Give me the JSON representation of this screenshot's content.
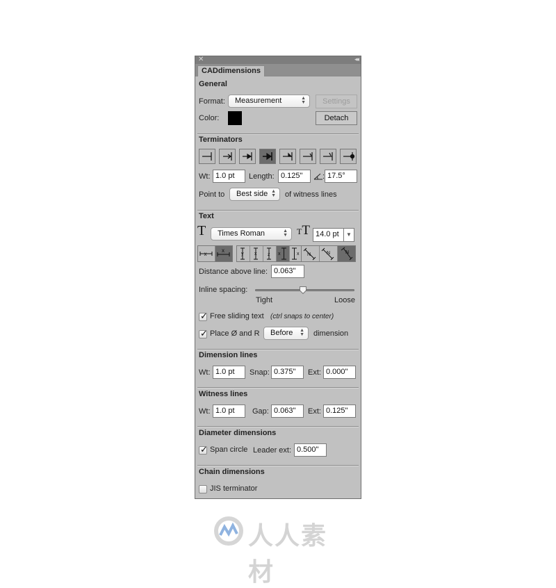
{
  "panel": {
    "close_icon": "close-icon",
    "collapse_icon": "double-chevron-left-icon",
    "tab_label": "CADdimensions"
  },
  "general": {
    "title": "General",
    "format_label": "Format:",
    "format_value": "Measurement",
    "settings_label": "Settings",
    "color_label": "Color:",
    "color_value": "#000000",
    "detach_label": "Detach"
  },
  "terminators": {
    "title": "Terminators",
    "styles": [
      {
        "name": "bar",
        "selected": false
      },
      {
        "name": "open-arrow-bar",
        "selected": false
      },
      {
        "name": "filled-arrow-bar",
        "selected": false
      },
      {
        "name": "bold-filled-arrow-bar",
        "selected": true
      },
      {
        "name": "half-arrow-bar",
        "selected": false
      },
      {
        "name": "slash-bar",
        "selected": false
      },
      {
        "name": "half-slash-bar",
        "selected": false
      },
      {
        "name": "dot-bar",
        "selected": false
      }
    ],
    "wt_label": "Wt:",
    "wt_value": "1.0 pt",
    "length_label": "Length:",
    "length_value": "0.125\"",
    "angle_icon": "angle-icon",
    "angle_value": "17.5°",
    "point_to_label": "Point to",
    "point_to_value": "Best side",
    "witness_suffix": "of witness lines"
  },
  "text": {
    "title": "Text",
    "font_icon": "font-T-icon",
    "font_value": "Times Roman",
    "size_icon": "font-size-T-icon",
    "size_value": "14.0 pt",
    "placement_group": [
      {
        "name": "inline-text",
        "selected": false
      },
      {
        "name": "above-line-text",
        "selected": true
      }
    ],
    "rotation_group": [
      {
        "name": "vertical-stack-1",
        "selected": false
      },
      {
        "name": "vertical-stack-2",
        "selected": false
      },
      {
        "name": "vertical-stack-3",
        "selected": false
      },
      {
        "name": "vertical-left",
        "selected": true
      },
      {
        "name": "vertical-right",
        "selected": false
      }
    ],
    "angle_group": [
      {
        "name": "aligned-1",
        "selected": false
      },
      {
        "name": "aligned-2",
        "selected": false
      },
      {
        "name": "aligned-3",
        "selected": true
      }
    ],
    "distance_label": "Distance above line:",
    "distance_value": "0.063\"",
    "inline_spacing_label": "Inline spacing:",
    "inline_spacing_fraction": 0.48,
    "tight_label": "Tight",
    "loose_label": "Loose",
    "free_sliding_checked": true,
    "free_sliding_label": "Free sliding text",
    "free_sliding_hint": "(ctrl snaps to center)",
    "place_checked": true,
    "place_label": "Place Ø and R",
    "place_value": "Before",
    "place_suffix": "dimension"
  },
  "dimension_lines": {
    "title": "Dimension lines",
    "wt_label": "Wt:",
    "wt_value": "1.0 pt",
    "snap_label": "Snap:",
    "snap_value": "0.375\"",
    "ext_label": "Ext:",
    "ext_value": "0.000\""
  },
  "witness_lines": {
    "title": "Witness lines",
    "wt_label": "Wt:",
    "wt_value": "1.0 pt",
    "gap_label": "Gap:",
    "gap_value": "0.063\"",
    "ext_label": "Ext:",
    "ext_value": "0.125\""
  },
  "diameter_dimensions": {
    "title": "Diameter dimensions",
    "span_checked": true,
    "span_label": "Span circle",
    "leader_label": "Leader ext:",
    "leader_value": "0.500\""
  },
  "chain_dimensions": {
    "title": "Chain dimensions",
    "jis_checked": false,
    "jis_label": "JIS terminator"
  },
  "watermark": {
    "text": "人人素材"
  }
}
